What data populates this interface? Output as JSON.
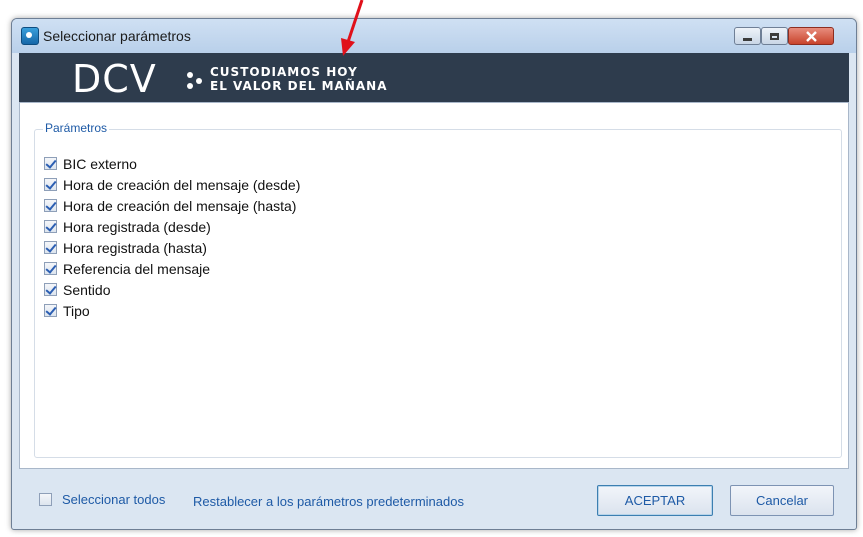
{
  "window": {
    "title": "Seleccionar parámetros"
  },
  "banner": {
    "logo": "DCV",
    "tagline_line1": "CUSTODIAMOS HOY",
    "tagline_line2": "EL VALOR DEL MAÑANA"
  },
  "parameters": {
    "group_label": "Parámetros",
    "items": [
      {
        "label": "BIC externo",
        "checked": true
      },
      {
        "label": "Hora de creación del mensaje (desde)",
        "checked": true
      },
      {
        "label": "Hora de creación del mensaje (hasta)",
        "checked": true
      },
      {
        "label": "Hora registrada (desde)",
        "checked": true
      },
      {
        "label": "Hora registrada (hasta)",
        "checked": true
      },
      {
        "label": "Referencia del mensaje",
        "checked": true
      },
      {
        "label": "Sentido",
        "checked": true
      },
      {
        "label": "Tipo",
        "checked": true
      }
    ]
  },
  "footer": {
    "select_all_label": "Seleccionar todos",
    "select_all_checked": false,
    "restore_link": "Restablecer a los parámetros predeterminados",
    "ok_label": "ACEPTAR",
    "cancel_label": "Cancelar"
  },
  "colors": {
    "accent": "#1e5aa6",
    "banner": "#2e3c4d",
    "annotation_arrow": "#e0101a"
  }
}
